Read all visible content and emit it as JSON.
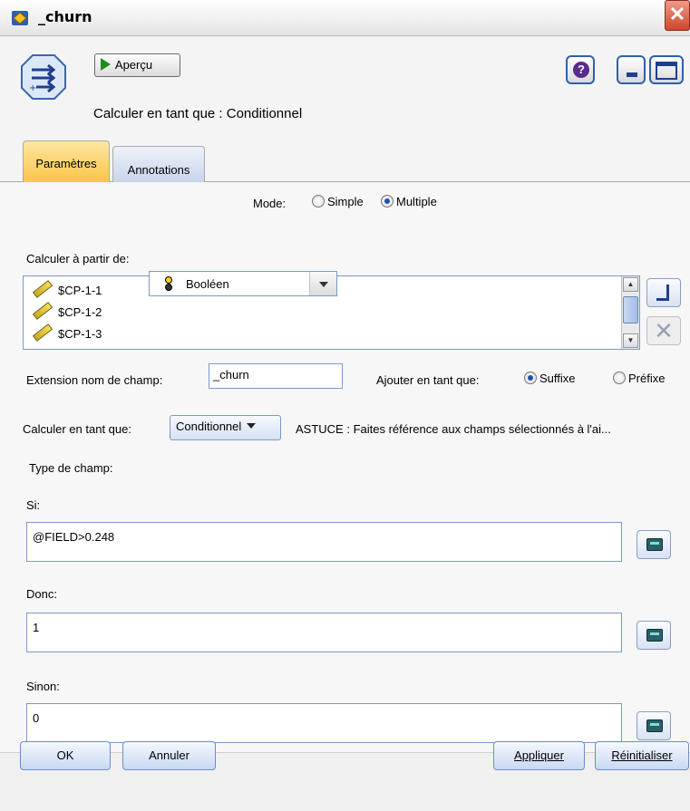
{
  "window": {
    "title": "_churn",
    "close_glyph": "✕"
  },
  "header": {
    "preview_label": "Aperçu",
    "help_glyph": "?",
    "caption": "Calculer en tant que : Conditionnel"
  },
  "tabs": [
    {
      "label": "Paramètres",
      "active": true
    },
    {
      "label": "Annotations",
      "active": false
    }
  ],
  "mode": {
    "label": "Mode:",
    "options": [
      "Simple",
      "Multiple"
    ],
    "selected": "Multiple"
  },
  "derive_from": {
    "label": "Calculer à partir de:",
    "fields": [
      "$CP-1-1",
      "$CP-1-2",
      "$CP-1-3"
    ]
  },
  "extension": {
    "label": "Extension nom de champ:",
    "value": "_churn",
    "add_as_label": "Ajouter en tant que:",
    "options": [
      "Suffixe",
      "Préfixe"
    ],
    "selected": "Suffixe"
  },
  "derive_as": {
    "label": "Calculer en tant que:",
    "value": "Conditionnel",
    "hint": "ASTUCE : Faites référence aux champs sélectionnés à l'ai..."
  },
  "field_type": {
    "label": "Type de champ:",
    "value": "Booléen"
  },
  "if_expr": {
    "label": "Si:",
    "value": "@FIELD>0.248"
  },
  "then_expr": {
    "label": "Donc:",
    "value": "1"
  },
  "else_expr": {
    "label": "Sinon:",
    "value": "0"
  },
  "buttons": {
    "ok": "OK",
    "cancel": "Annuler",
    "apply": "Appliquer",
    "reset": "Réinitialiser"
  },
  "icons": {
    "title_icon": "diamond-node-icon",
    "node_icon": "derive-arrows-icon",
    "field_icon": "ruler-continuous-icon",
    "bool_icon": "boolean-flag-icon"
  },
  "colors": {
    "active_tab": "#fbc54a",
    "button_border": "#6c8dc7",
    "close": "#d0452c"
  }
}
